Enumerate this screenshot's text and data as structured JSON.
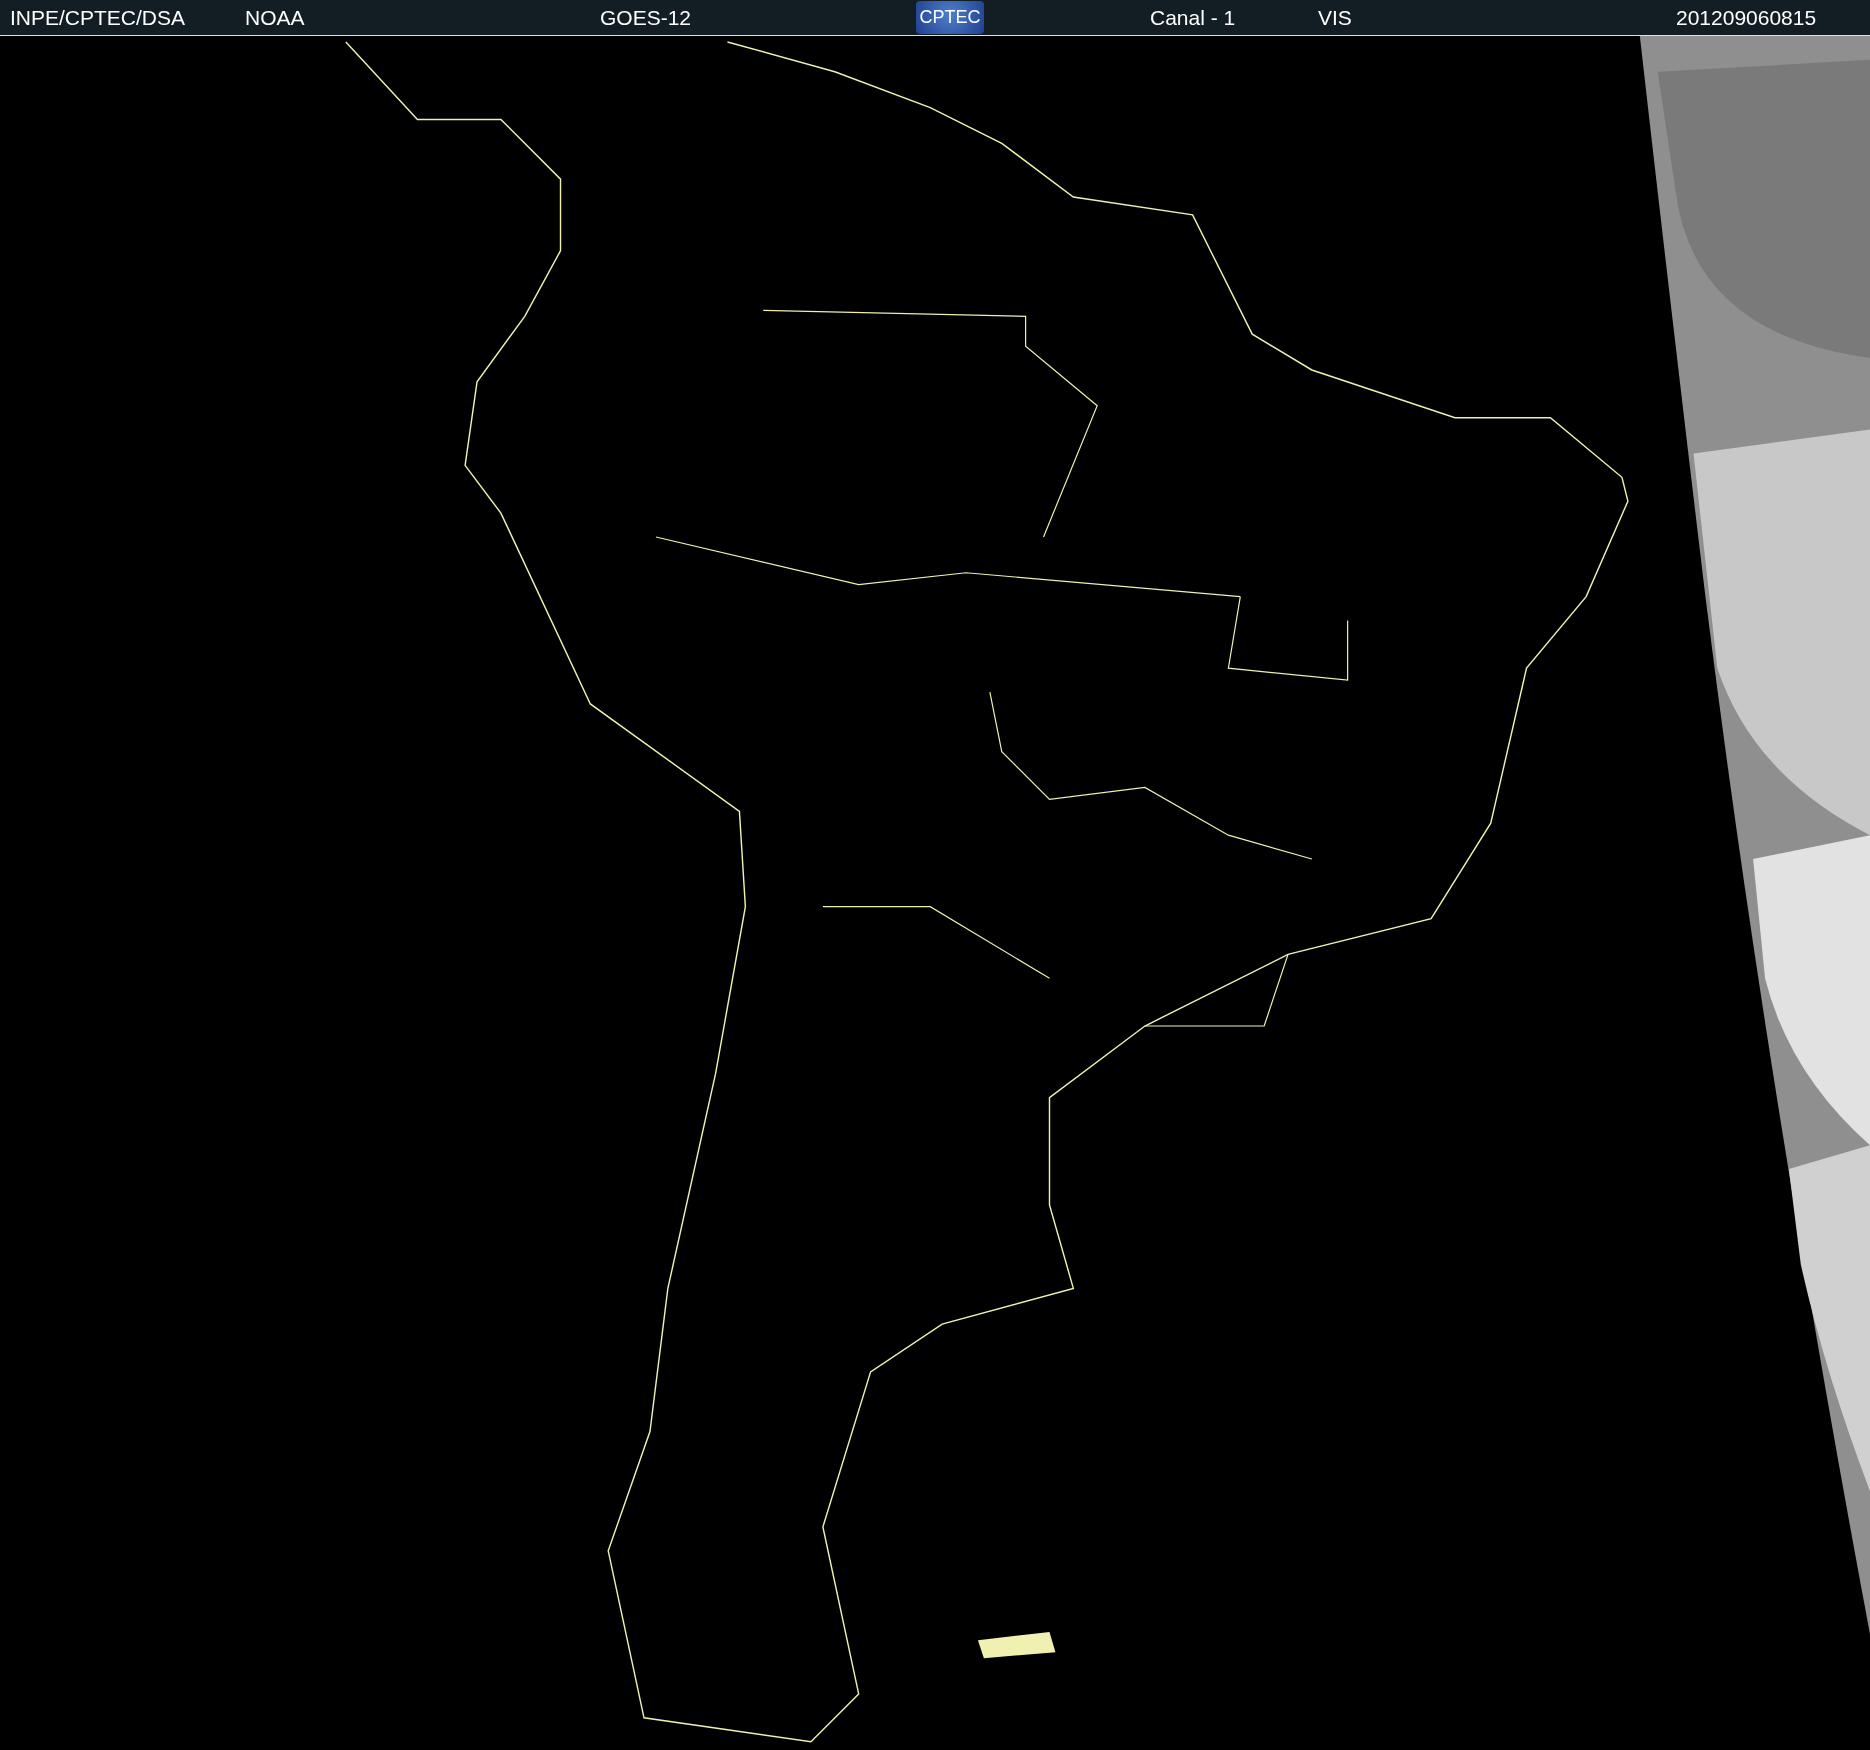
{
  "header": {
    "source": "INPE/CPTEC/DSA",
    "agency": "NOAA",
    "satellite": "GOES-12",
    "logo": "CPTEC",
    "channel": "Canal - 1",
    "band": "VIS",
    "timestamp": "201209060815"
  }
}
